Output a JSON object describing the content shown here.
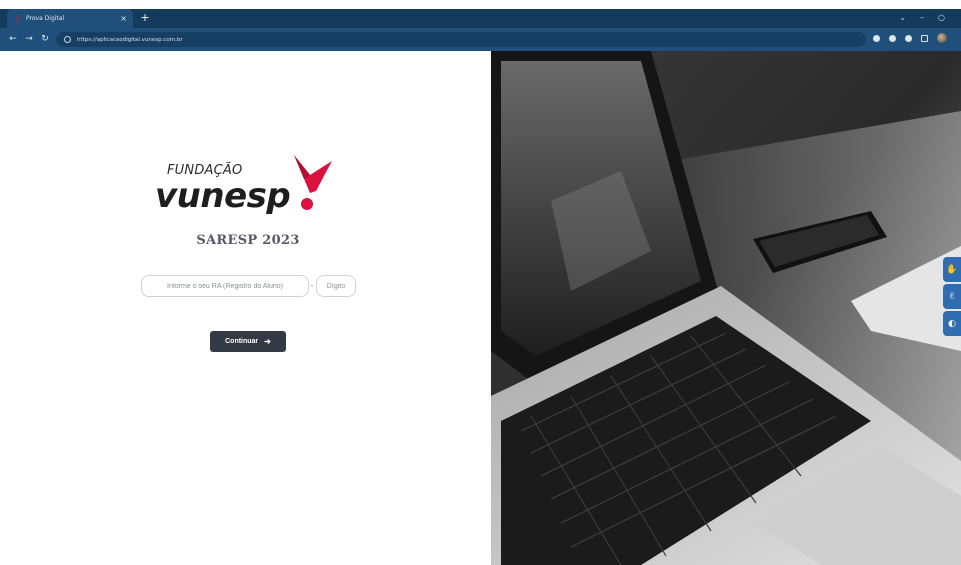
{
  "browser": {
    "tab_title": "Prova Digital",
    "tab_close": "×",
    "new_tab": "+",
    "url": "https://aplicacaodigital.vunesp.com.br",
    "win_controls": [
      "⌄",
      "–",
      "○"
    ]
  },
  "logo": {
    "top_text": "FUNDAÇÃO",
    "main_text": "vunesp",
    "mark_color": "#d9123f"
  },
  "exam_title": "SARESP 2023",
  "form": {
    "ra_placeholder": "Informe o seu RA (Registro do Aluno)",
    "separator": "-",
    "digito_placeholder": "Dígito",
    "submit_label": "Continuar",
    "submit_icon": "sign-in-icon"
  },
  "colors": {
    "browser_chrome": "#1f4f7a",
    "button_bg": "#343a43",
    "brand_accent": "#d9123f",
    "side_widget": "#2f6db0"
  },
  "side_widget": {
    "icons": [
      "accessibility-hand-icon",
      "sign-language-icon",
      "eye-contrast-icon"
    ]
  }
}
